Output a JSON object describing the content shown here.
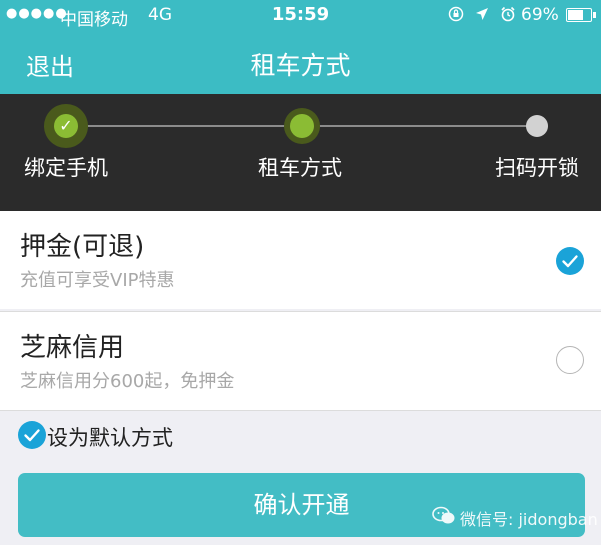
{
  "status_bar": {
    "signal": "●●●●●",
    "carrier": "中国移动",
    "network": "4G",
    "time": "15:59",
    "battery_percent": "69%",
    "battery_level": 0.69,
    "icons": [
      "lock-rotation-icon",
      "location-arrow-icon",
      "alarm-icon"
    ]
  },
  "nav": {
    "back_label": "退出",
    "title": "租车方式"
  },
  "stepper": {
    "steps": [
      {
        "label": "绑定手机",
        "state": "done"
      },
      {
        "label": "租车方式",
        "state": "current"
      },
      {
        "label": "扫码开锁",
        "state": "pending"
      }
    ]
  },
  "options": [
    {
      "title": "押金(可退)",
      "subtitle": "充值可享受VIP特惠",
      "selected": true
    },
    {
      "title": "芝麻信用",
      "subtitle": "芝麻信用分600起，免押金",
      "selected": false
    }
  ],
  "default_setting": {
    "label": "设为默认方式",
    "checked": true
  },
  "confirm_button": {
    "label": "确认开通"
  },
  "watermark": {
    "text": "微信号: jidongban"
  },
  "colors": {
    "accent": "#3cbcc4",
    "stepper_bg": "#2b2b2b",
    "step_active": "#8bbc34",
    "check_blue": "#1aa3d8"
  }
}
